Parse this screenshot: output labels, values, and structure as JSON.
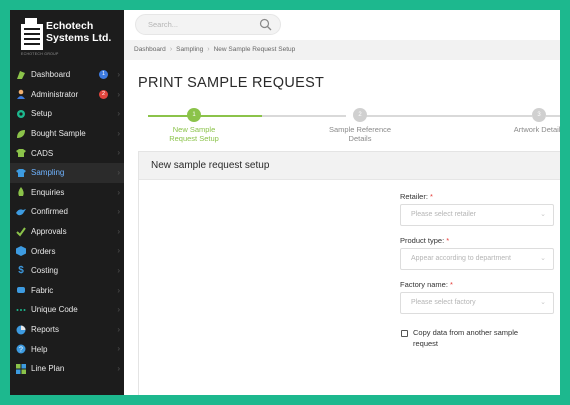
{
  "brand": {
    "name_line1": "Echotech",
    "name_line2": "Systems Ltd.",
    "tagline": "ECHOTECH GROUP"
  },
  "sidebar": {
    "items": [
      {
        "label": "Dashboard",
        "icon": "dashboard-icon",
        "badge": "1",
        "badge_color": "#3d7be0"
      },
      {
        "label": "Administrator",
        "icon": "user-icon",
        "badge": "2",
        "badge_color": "#e0453d"
      },
      {
        "label": "Setup",
        "icon": "gear-icon"
      },
      {
        "label": "Bought Sample",
        "icon": "leaf-icon"
      },
      {
        "label": "CADS",
        "icon": "shirt-icon"
      },
      {
        "label": "Sampling",
        "icon": "shirt-icon",
        "active": true
      },
      {
        "label": "Enquiries",
        "icon": "flame-icon"
      },
      {
        "label": "Confirmed",
        "icon": "bird-icon"
      },
      {
        "label": "Approvals",
        "icon": "checkmark-icon"
      },
      {
        "label": "Orders",
        "icon": "cube-icon"
      },
      {
        "label": "Costing",
        "icon": "dollar-icon"
      },
      {
        "label": "Fabric",
        "icon": "fabric-icon"
      },
      {
        "label": "Unique Code",
        "icon": "dots-icon"
      },
      {
        "label": "Reports",
        "icon": "pie-chart-icon"
      },
      {
        "label": "Help",
        "icon": "help-icon"
      },
      {
        "label": "Line Plan",
        "icon": "puzzle-icon"
      }
    ]
  },
  "search": {
    "placeholder": "Search..."
  },
  "breadcrumb": [
    "Dashboard",
    "Sampling",
    "New Sample Request Setup"
  ],
  "page": {
    "title": "PRINT SAMPLE REQUEST"
  },
  "steps": [
    {
      "number": "1",
      "label_line1": "New Sample",
      "label_line2": "Request Setup",
      "active": true
    },
    {
      "number": "2",
      "label_line1": "Sample Reference",
      "label_line2": "Details"
    },
    {
      "number": "3",
      "label_line1": "Artwork Details",
      "label_line2": ""
    }
  ],
  "form": {
    "heading": "New sample request setup",
    "retailer": {
      "label": "Retailer:",
      "required": "*",
      "placeholder": "Please select retailer"
    },
    "product_type": {
      "label": "Product type:",
      "required": "*",
      "placeholder": "Appear according to department"
    },
    "factory_name": {
      "label": "Factory name:",
      "required": "*",
      "placeholder": "Please select factory"
    },
    "copy_checkbox": {
      "label": "Copy data from another sample request",
      "checked": false
    }
  },
  "colors": {
    "accent_green": "#8bc34a",
    "frame_green": "#1db88e",
    "sidebar_active_text": "#6fb3ff",
    "sidebar_bg": "#1c1c1c"
  }
}
